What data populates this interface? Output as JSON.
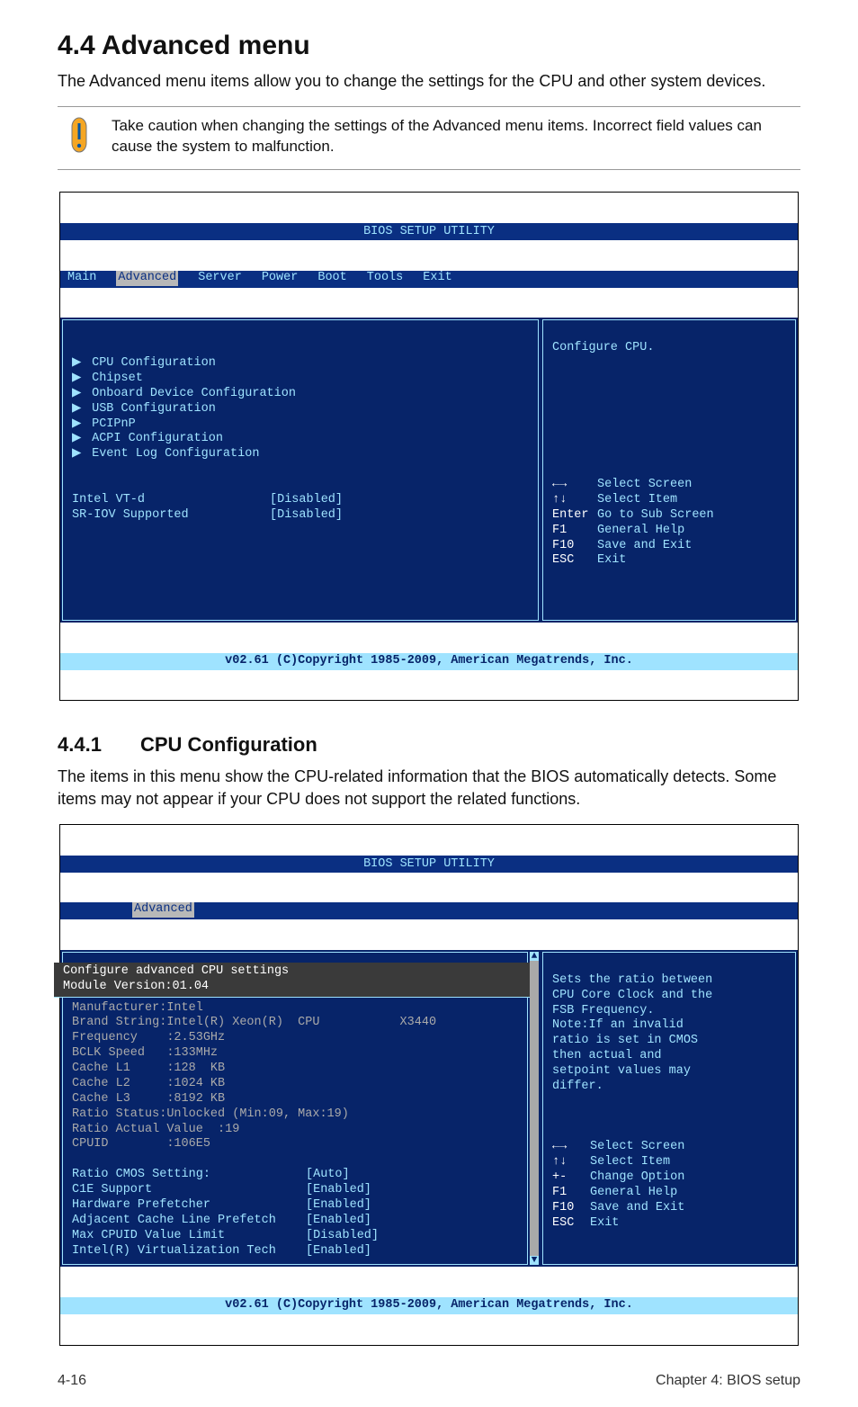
{
  "heading": "4.4     Advanced menu",
  "intro": "The Advanced menu items allow you to change the settings for the CPU and other system devices.",
  "caution": "Take caution when changing the settings of the Advanced menu items. Incorrect field values can cause the system to malfunction.",
  "bios1": {
    "title_center": "BIOS SETUP UTILITY",
    "tabs": [
      "Main",
      "Advanced",
      "Server",
      "Power",
      "Boot",
      "Tools",
      "Exit"
    ],
    "active_tab": "Advanced",
    "menu_items": [
      "CPU Configuration",
      "Chipset",
      "Onboard Device Configuration",
      "USB Configuration",
      "PCIPnP",
      "ACPI Configuration",
      "Event Log Configuration"
    ],
    "settings": [
      {
        "label": "Intel VT-d",
        "value": "[Disabled]"
      },
      {
        "label": "SR-IOV Supported",
        "value": "[Disabled]"
      }
    ],
    "help_top": "Configure CPU.",
    "help_nav": [
      {
        "key": "←→",
        "txt": "Select Screen"
      },
      {
        "key": "↑↓",
        "txt": "Select Item"
      },
      {
        "key": "Enter",
        "txt": "Go to Sub Screen"
      },
      {
        "key": "F1",
        "txt": "General Help"
      },
      {
        "key": "F10",
        "txt": "Save and Exit"
      },
      {
        "key": "ESC",
        "txt": "Exit"
      }
    ],
    "footer": "v02.61 (C)Copyright 1985-2009, American Megatrends, Inc."
  },
  "subsection_num": "4.4.1",
  "subsection_title": "CPU Configuration",
  "subintro": "The items in this menu show the CPU-related information that the BIOS automatically detects. Some items may not appear if your CPU does not support the related functions.",
  "bios2": {
    "title_center": "BIOS SETUP UTILITY",
    "active_tab": "Advanced",
    "head_line": "Configure advanced CPU settings",
    "module_line": "Module Version:01.04",
    "info_lines": [
      "Manufacturer:Intel",
      "Brand String:Intel(R) Xeon(R)  CPU           X3440",
      "Frequency    :2.53GHz",
      "BCLK Speed   :133MHz",
      "Cache L1     :128  KB",
      "Cache L2     :1024 KB",
      "Cache L3     :8192 KB",
      "Ratio Status:Unlocked (Min:09, Max:19)",
      "Ratio Actual Value  :19",
      "CPUID        :106E5"
    ],
    "settings": [
      {
        "label": "Ratio CMOS Setting:",
        "value": "[Auto]"
      },
      {
        "label": "C1E Support",
        "value": "[Enabled]"
      },
      {
        "label": "Hardware Prefetcher",
        "value": "[Enabled]"
      },
      {
        "label": "Adjacent Cache Line Prefetch",
        "value": "[Enabled]"
      },
      {
        "label": "Max CPUID Value Limit",
        "value": "[Disabled]"
      },
      {
        "label": "Intel(R) Virtualization Tech",
        "value": "[Enabled]"
      }
    ],
    "help_top_lines": [
      "Sets the ratio between",
      "CPU Core Clock and the",
      "FSB Frequency.",
      "Note:If an invalid",
      "ratio is set in CMOS",
      "then actual and",
      "setpoint values may",
      "differ."
    ],
    "help_nav": [
      {
        "key": "←→",
        "txt": "Select Screen"
      },
      {
        "key": "↑↓",
        "txt": "Select Item"
      },
      {
        "key": "+-",
        "txt": "Change Option"
      },
      {
        "key": "F1",
        "txt": "General Help"
      },
      {
        "key": "F10",
        "txt": "Save and Exit"
      },
      {
        "key": "ESC",
        "txt": "Exit"
      }
    ],
    "footer": "v02.61 (C)Copyright 1985-2009, American Megatrends, Inc."
  },
  "page_footer_left": "4-16",
  "page_footer_right": "Chapter 4: BIOS setup"
}
